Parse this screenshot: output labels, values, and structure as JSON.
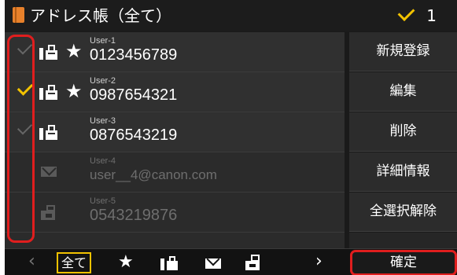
{
  "header": {
    "title": "アドレス帳（全て）",
    "selected_count": "1"
  },
  "entries": [
    {
      "user": "User-1",
      "number": "0123456789",
      "checked": false,
      "type": "fax-icon",
      "favorite": true,
      "enabled": true
    },
    {
      "user": "User-2",
      "number": "0987654321",
      "checked": true,
      "type": "fax-icon",
      "favorite": true,
      "enabled": true
    },
    {
      "user": "User-3",
      "number": "0876543219",
      "checked": false,
      "type": "fax-icon",
      "favorite": false,
      "enabled": true
    },
    {
      "user": "User-4",
      "number": "user__4@canon.com",
      "checked": false,
      "type": "mail-icon",
      "favorite": false,
      "enabled": false
    },
    {
      "user": "User-5",
      "number": "0543219876",
      "checked": false,
      "type": "group-icon",
      "favorite": false,
      "enabled": false
    }
  ],
  "side_buttons": {
    "register": "新規登録",
    "edit": "編集",
    "delete": "削除",
    "details": "詳細情報",
    "deselect_all": "全選択解除"
  },
  "bottom_bar": {
    "all_label": "全て",
    "prev": "‹",
    "next": "›",
    "star": "★",
    "confirm": "確定"
  },
  "colors": {
    "accent": "#f2c200",
    "highlight_outline": "#e01e1e",
    "address_book_icon": "#e8812b"
  }
}
